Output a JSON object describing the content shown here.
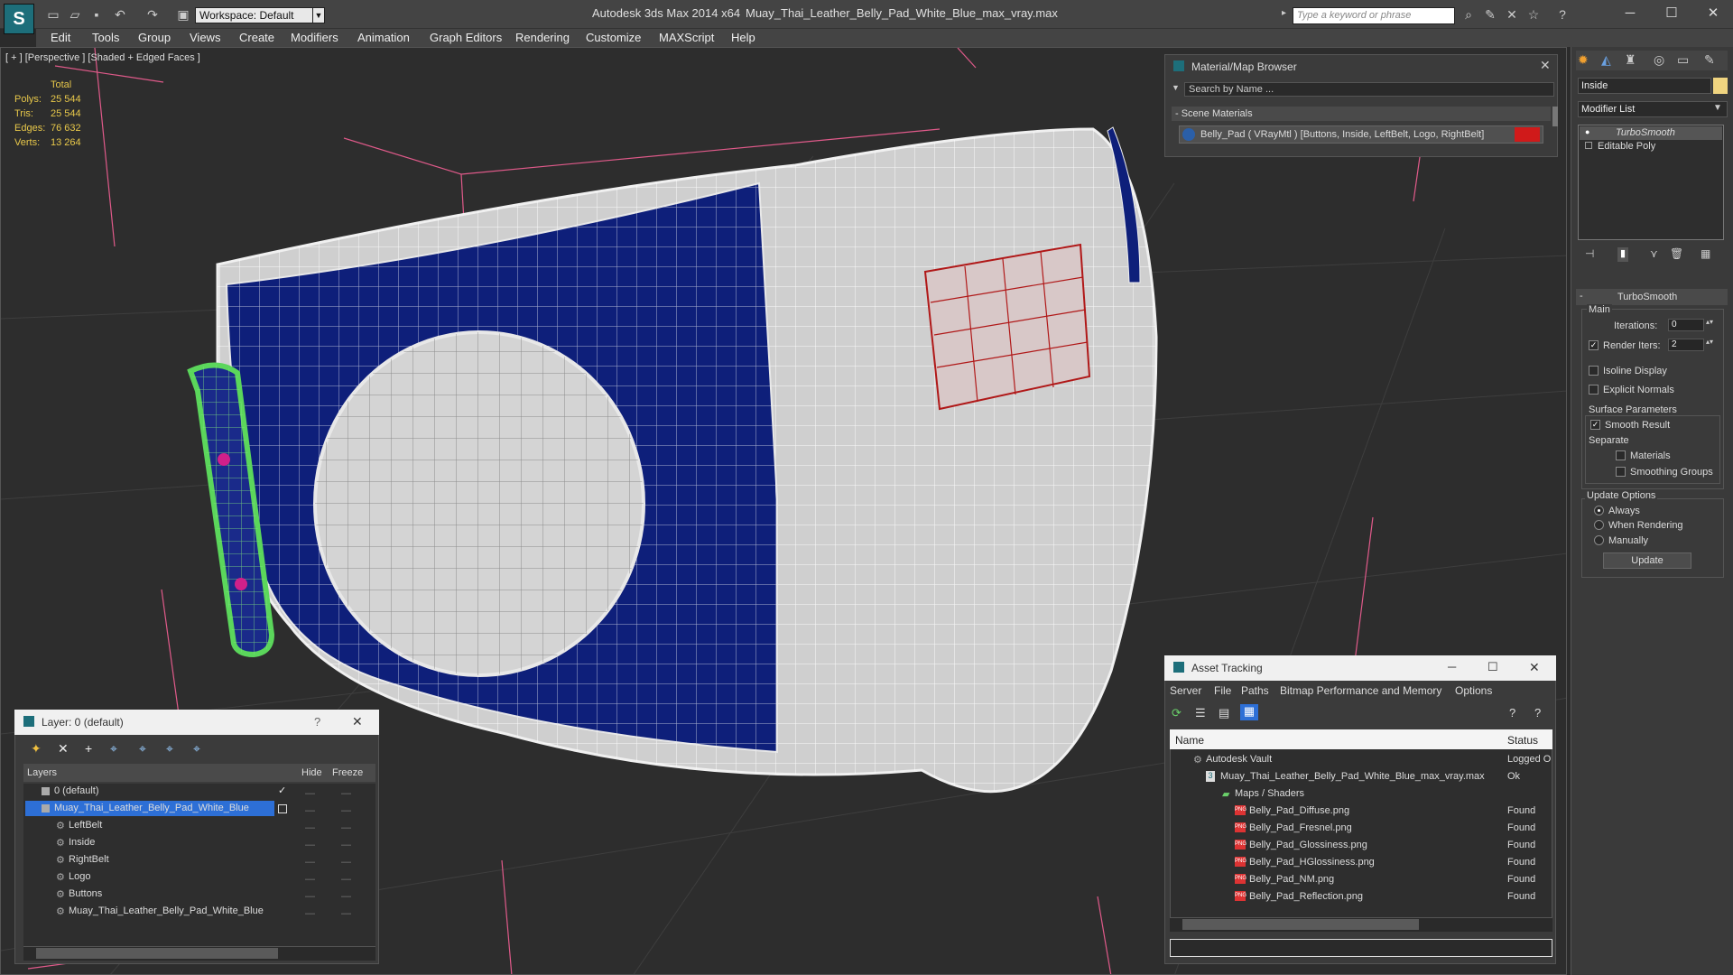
{
  "titlebar": {
    "workspace": "Workspace: Default",
    "app_title": "Autodesk 3ds Max  2014 x64",
    "file_title": "Muay_Thai_Leather_Belly_Pad_White_Blue_max_vray.max",
    "search_placeholder": "Type a keyword or phrase"
  },
  "menu": [
    "Edit",
    "Tools",
    "Group",
    "Views",
    "Create",
    "Modifiers",
    "Animation",
    "Graph Editors",
    "Rendering",
    "Customize",
    "MAXScript",
    "Help"
  ],
  "viewport": {
    "label": "[ + ] [Perspective ] [Shaded + Edged Faces ]",
    "stats": {
      "total_label": "Total",
      "rows": [
        {
          "label": "Polys:",
          "value": "25 544"
        },
        {
          "label": "Tris:",
          "value": "25 544"
        },
        {
          "label": "Edges:",
          "value": "76 632"
        },
        {
          "label": "Verts:",
          "value": "13 264"
        }
      ]
    }
  },
  "material_browser": {
    "title": "Material/Map Browser",
    "search_placeholder": "Search by Name ...",
    "section": "- Scene Materials",
    "material": "Belly_Pad  ( VRayMtl ) [Buttons, Inside, LeftBelt, Logo, RightBelt]"
  },
  "command_panel": {
    "object_name": "Inside",
    "modifier_list": "Modifier List",
    "stack": [
      "TurboSmooth",
      "Editable Poly"
    ],
    "rollout_title": "TurboSmooth",
    "main_label": "Main",
    "iterations_label": "Iterations:",
    "iterations_value": "0",
    "render_iters_label": "Render Iters:",
    "render_iters_value": "2",
    "isoline": "Isoline Display",
    "explicit_normals": "Explicit Normals",
    "surface_params": "Surface Parameters",
    "smooth_result": "Smooth Result",
    "separate": "Separate",
    "materials": "Materials",
    "smoothing_groups": "Smoothing Groups",
    "update_options": "Update Options",
    "always": "Always",
    "when_rendering": "When Rendering",
    "manually": "Manually",
    "update_button": "Update"
  },
  "layer_panel": {
    "title": "Layer: 0 (default)",
    "help": "?",
    "col_layers": "Layers",
    "col_hide": "Hide",
    "col_freeze": "Freeze",
    "rows": [
      {
        "name": "0 (default)",
        "indent": 1
      },
      {
        "name": "Muay_Thai_Leather_Belly_Pad_White_Blue",
        "indent": 1,
        "selected": true
      },
      {
        "name": "LeftBelt",
        "indent": 2
      },
      {
        "name": "Inside",
        "indent": 2
      },
      {
        "name": "RightBelt",
        "indent": 2
      },
      {
        "name": "Logo",
        "indent": 2
      },
      {
        "name": "Buttons",
        "indent": 2
      },
      {
        "name": "Muay_Thai_Leather_Belly_Pad_White_Blue",
        "indent": 2
      }
    ]
  },
  "asset_tracking": {
    "title": "Asset Tracking",
    "menu": [
      "Server",
      "File",
      "Paths",
      "Bitmap Performance and Memory",
      "Options"
    ],
    "col_name": "Name",
    "col_status": "Status",
    "rows": [
      {
        "name": "Autodesk Vault",
        "status": "Logged O",
        "indent": 1
      },
      {
        "name": "Muay_Thai_Leather_Belly_Pad_White_Blue_max_vray.max",
        "status": "Ok",
        "indent": 2
      },
      {
        "name": "Maps / Shaders",
        "status": "",
        "indent": 3
      },
      {
        "name": "Belly_Pad_Diffuse.png",
        "status": "Found",
        "indent": 4
      },
      {
        "name": "Belly_Pad_Fresnel.png",
        "status": "Found",
        "indent": 4
      },
      {
        "name": "Belly_Pad_Glossiness.png",
        "status": "Found",
        "indent": 4
      },
      {
        "name": "Belly_Pad_HGlossiness.png",
        "status": "Found",
        "indent": 4
      },
      {
        "name": "Belly_Pad_NM.png",
        "status": "Found",
        "indent": 4
      },
      {
        "name": "Belly_Pad_Reflection.png",
        "status": "Found",
        "indent": 4
      }
    ]
  },
  "colors": {
    "accent": "#1f4f9c",
    "blue_leather": "#0e1f7a",
    "selection": "#2d6fd6"
  }
}
